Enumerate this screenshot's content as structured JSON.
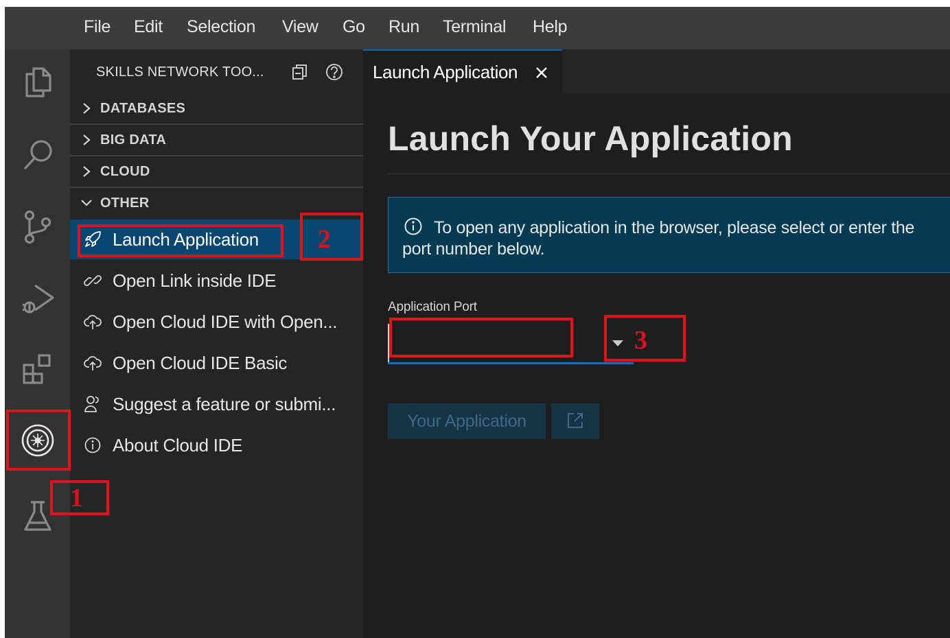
{
  "menubar": {
    "items": [
      "File",
      "Edit",
      "Selection",
      "View",
      "Go",
      "Run",
      "Terminal",
      "Help"
    ]
  },
  "activity_bar": {
    "icons": [
      "explorer-icon",
      "search-icon",
      "source-control-icon",
      "run-debug-icon",
      "extensions-icon",
      "skills-network-icon",
      "flask-icon"
    ]
  },
  "sidebar": {
    "title": "SKILLS NETWORK TOO...",
    "sections": [
      {
        "label": "DATABASES",
        "expanded": false
      },
      {
        "label": "BIG DATA",
        "expanded": false
      },
      {
        "label": "CLOUD",
        "expanded": false
      },
      {
        "label": "OTHER",
        "expanded": true
      }
    ],
    "items": [
      {
        "label": "Launch Application",
        "icon": "rocket-icon"
      },
      {
        "label": "Open Link inside IDE",
        "icon": "link-icon"
      },
      {
        "label": "Open Cloud IDE with Open...",
        "icon": "cloud-upload-icon"
      },
      {
        "label": "Open Cloud IDE Basic",
        "icon": "cloud-upload-icon"
      },
      {
        "label": "Suggest a feature or submi...",
        "icon": "person-icon"
      },
      {
        "label": "About Cloud IDE",
        "icon": "info-icon"
      }
    ]
  },
  "editor": {
    "tab_label": "Launch Application",
    "heading": "Launch Your Application",
    "info_text": "To open any application in the browser, please select or enter the port number below.",
    "port_label": "Application Port",
    "port_value": "",
    "app_button": "Your Application"
  },
  "annotations": {
    "one": "1",
    "two": "2",
    "three": "3"
  },
  "colors": {
    "accent": "#0e639c",
    "selected_item": "#094771",
    "annotation": "#e0121b"
  }
}
